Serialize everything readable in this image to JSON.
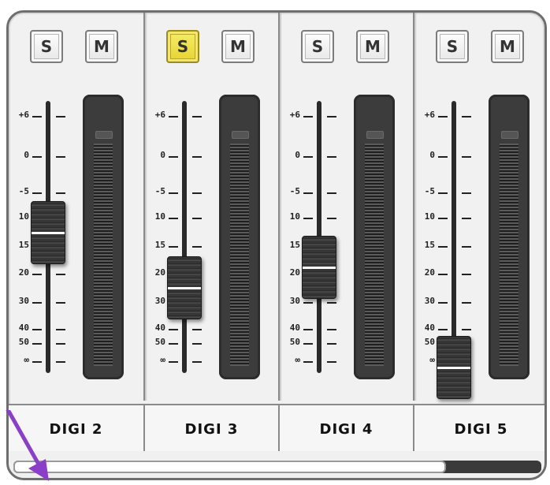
{
  "buttons": {
    "solo_label": "S",
    "mute_label": "M"
  },
  "scale_labels": [
    "+6",
    "0",
    "-5",
    "10",
    "15",
    "20",
    "30",
    "40",
    "50",
    "∞"
  ],
  "channels": [
    {
      "name": "DIGI 2",
      "solo_active": false,
      "fader_position": 0.45
    },
    {
      "name": "DIGI 3",
      "solo_active": true,
      "fader_position": 0.64
    },
    {
      "name": "DIGI 4",
      "solo_active": false,
      "fader_position": 0.57
    },
    {
      "name": "DIGI 5",
      "solo_active": false,
      "fader_position": 0.95
    }
  ],
  "scrollbar": {
    "visible_fraction": 0.82
  },
  "colors": {
    "solo_active": "#ecdc3a",
    "annotation_arrow": "#8b3fc9",
    "meter_background": "#3c3c3c"
  },
  "icons": [
    "annotation-arrow-icon"
  ]
}
